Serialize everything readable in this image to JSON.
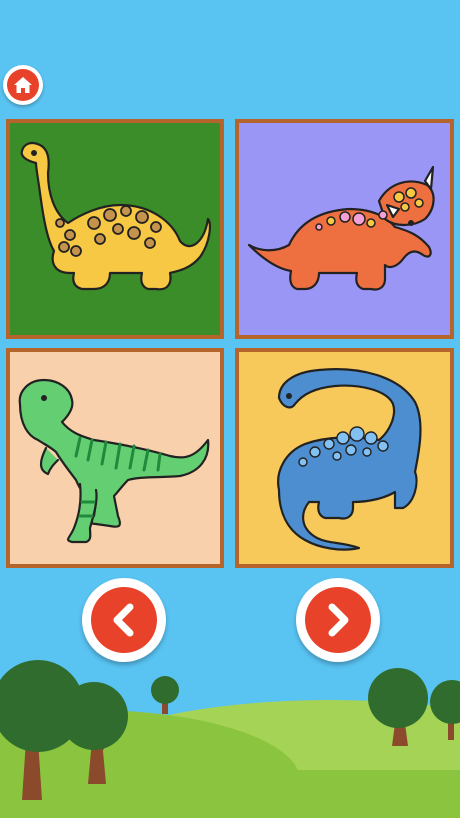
{
  "app": {
    "screen": "dinosaur-coloring-page-picker"
  },
  "colors": {
    "sky": "#59C3F2",
    "button_red": "#E8432A",
    "tile_border": "#B5652B",
    "grass": "#8BC53F",
    "hill_light": "#A4D356"
  },
  "home_button": {
    "icon": "home-icon"
  },
  "tiles": [
    {
      "id": 1,
      "background": "#3A8D28",
      "dinosaur": "yellow-brachiosaurus",
      "dino_color": "#F6C843"
    },
    {
      "id": 2,
      "background": "#9A96F6",
      "dinosaur": "orange-triceratops",
      "dino_color": "#EE7040"
    },
    {
      "id": 3,
      "background": "#F8D0AB",
      "dinosaur": "green-tyrannosaurus",
      "dino_color": "#64CE72"
    },
    {
      "id": 4,
      "background": "#F7C95A",
      "dinosaur": "blue-diplodocus",
      "dino_color": "#4C8ECF"
    }
  ],
  "navigation": {
    "prev": {
      "icon": "chevron-left-icon"
    },
    "next": {
      "icon": "chevron-right-icon"
    }
  }
}
